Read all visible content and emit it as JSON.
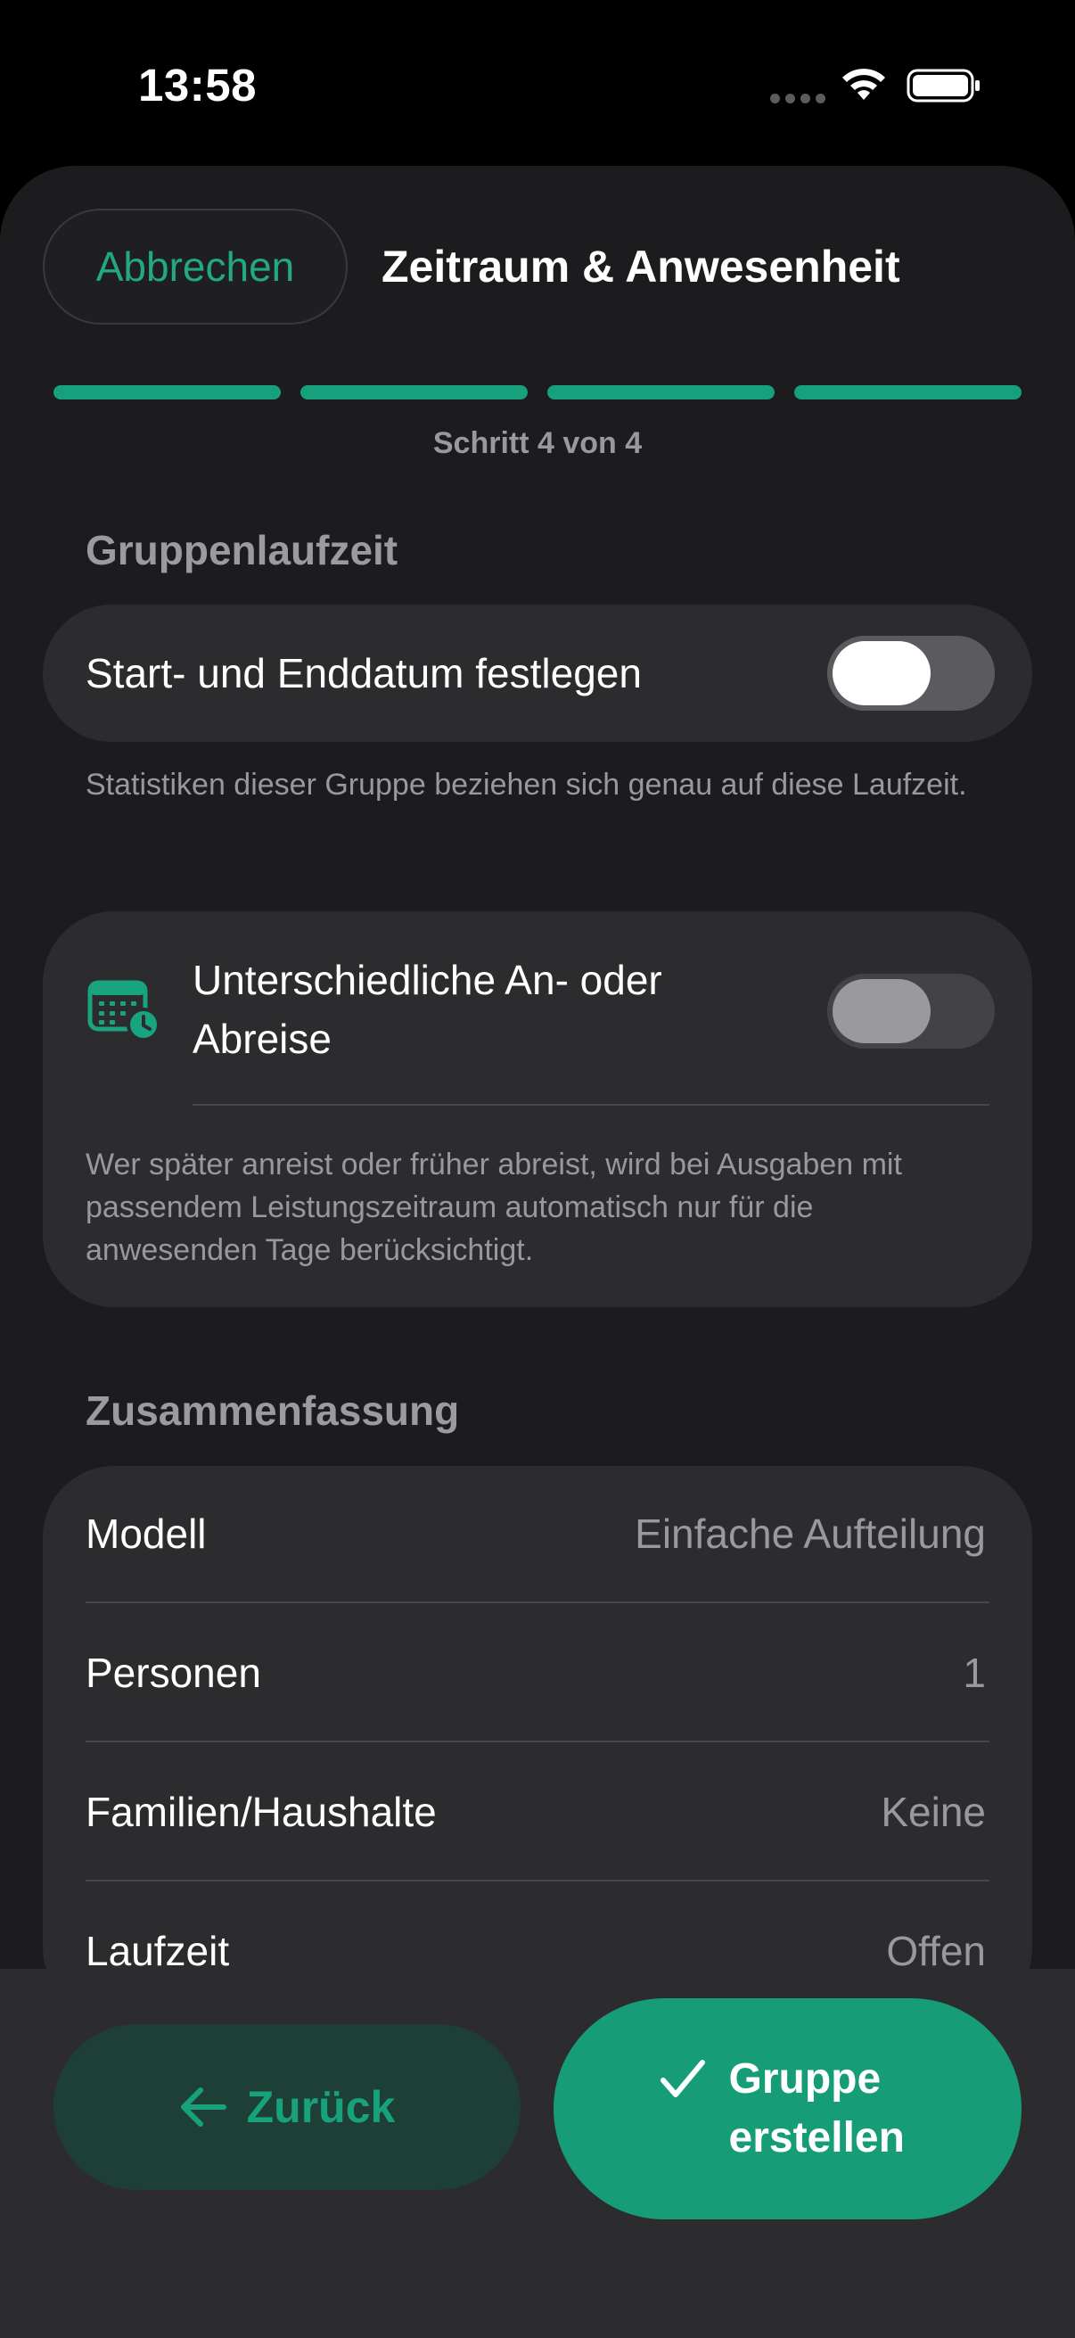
{
  "status_bar": {
    "time": "13:58"
  },
  "header": {
    "cancel_label": "Abbrechen",
    "title": "Zeitraum & Anwesenheit",
    "step_label": "Schritt 4 von 4",
    "progress": {
      "current_step": 4,
      "total_steps": 4
    }
  },
  "runtime_section": {
    "heading": "Gruppenlaufzeit",
    "toggle_label": "Start- und Enddatum festlegen",
    "toggle_on": false,
    "footnote": "Statistiken dieser Gruppe beziehen sich genau auf diese Laufzeit."
  },
  "attendance_section": {
    "toggle_label": "Unterschiedliche An- oder Abreise",
    "toggle_on": false,
    "icon": "calendar-clock-icon",
    "footnote": "Wer später anreist oder früher abreist, wird bei Ausgaben mit passendem Leistungszeitraum automatisch nur für die anwesenden Tage berücksichtigt."
  },
  "summary": {
    "heading": "Zusammenfassung",
    "rows": [
      {
        "key": "Modell",
        "value": "Einfache Aufteilung"
      },
      {
        "key": "Personen",
        "value": "1"
      },
      {
        "key": "Familien/Haushalte",
        "value": "Keine"
      },
      {
        "key": "Laufzeit",
        "value": "Offen"
      }
    ]
  },
  "footer": {
    "back_label": "Zurück",
    "create_label": "Gruppe erstellen"
  },
  "colors": {
    "accent": "#16a07c",
    "background": "#1c1c1e",
    "card": "#2c2c2e"
  }
}
